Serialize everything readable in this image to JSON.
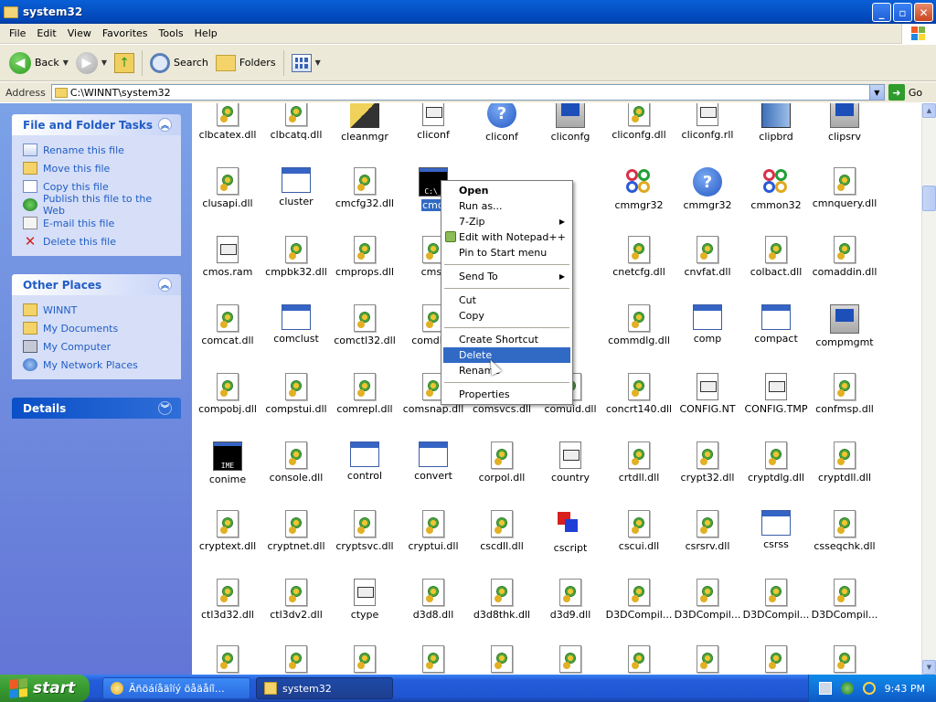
{
  "window": {
    "title": "system32"
  },
  "menubar": [
    "File",
    "Edit",
    "View",
    "Favorites",
    "Tools",
    "Help"
  ],
  "toolbar": {
    "back": "Back",
    "search": "Search",
    "folders": "Folders"
  },
  "address": {
    "label": "Address",
    "value": "C:\\WINNT\\system32",
    "go": "Go"
  },
  "left_pane": {
    "file_tasks": {
      "title": "File and Folder Tasks",
      "items": [
        "Rename this file",
        "Move this file",
        "Copy this file",
        "Publish this file to the Web",
        "E-mail this file",
        "Delete this file"
      ]
    },
    "other_places": {
      "title": "Other Places",
      "items": [
        "WINNT",
        "My Documents",
        "My Computer",
        "My Network Places"
      ]
    },
    "details": {
      "title": "Details"
    }
  },
  "files": [
    [
      "clbcatex.dll",
      "clbcatq.dll",
      "cleanmgr",
      "cliconf",
      "cliconf",
      "cliconfg",
      "cliconfg.dll",
      "cliconfg.rll",
      "clipbrd",
      "clipsrv"
    ],
    [
      "clusapi.dll",
      "cluster",
      "cmcfg32.dll",
      "cmd",
      "",
      "",
      "cmmgr32",
      "cmmgr32",
      "cmmon32",
      "cmnquery.dll"
    ],
    [
      "cmos.ram",
      "cmpbk32.dll",
      "cmprops.dll",
      "cmst",
      "",
      "",
      "cnetcfg.dll",
      "cnvfat.dll",
      "colbact.dll",
      "comaddin.dll"
    ],
    [
      "comcat.dll",
      "comclust",
      "comctl32.dll",
      "comdlg3",
      "",
      "",
      "commdlg.dll",
      "comp",
      "compact",
      "compmgmt"
    ],
    [
      "compobj.dll",
      "compstui.dll",
      "comrepl.dll",
      "comsnap.dll",
      "comsvcs.dll",
      "comuid.dll",
      "concrt140.dll",
      "CONFIG.NT",
      "CONFIG.TMP",
      "confmsp.dll"
    ],
    [
      "conime",
      "console.dll",
      "control",
      "convert",
      "corpol.dll",
      "country",
      "crtdll.dll",
      "crypt32.dll",
      "cryptdlg.dll",
      "cryptdll.dll"
    ],
    [
      "cryptext.dll",
      "cryptnet.dll",
      "cryptsvc.dll",
      "cryptui.dll",
      "cscdll.dll",
      "cscript",
      "cscui.dll",
      "csrsrv.dll",
      "csrss",
      "csseqchk.dll"
    ],
    [
      "ctl3d32.dll",
      "ctl3dv2.dll",
      "ctype",
      "d3d8.dll",
      "d3d8thk.dll",
      "d3d9.dll",
      "D3DCompil...",
      "D3DCompil...",
      "D3DCompil...",
      "D3DCompil..."
    ]
  ],
  "context_menu": {
    "items": [
      "Open",
      "Run as...",
      "7-Zip",
      "Edit with Notepad++",
      "Pin to Start menu",
      "Send To",
      "Cut",
      "Copy",
      "Create Shortcut",
      "Delete",
      "Rename",
      "Properties"
    ]
  },
  "taskbar": {
    "start": "start",
    "buttons": [
      "Ãñöáíåäîíý öåäåíî…",
      "system32"
    ],
    "clock": "9:43 PM"
  }
}
